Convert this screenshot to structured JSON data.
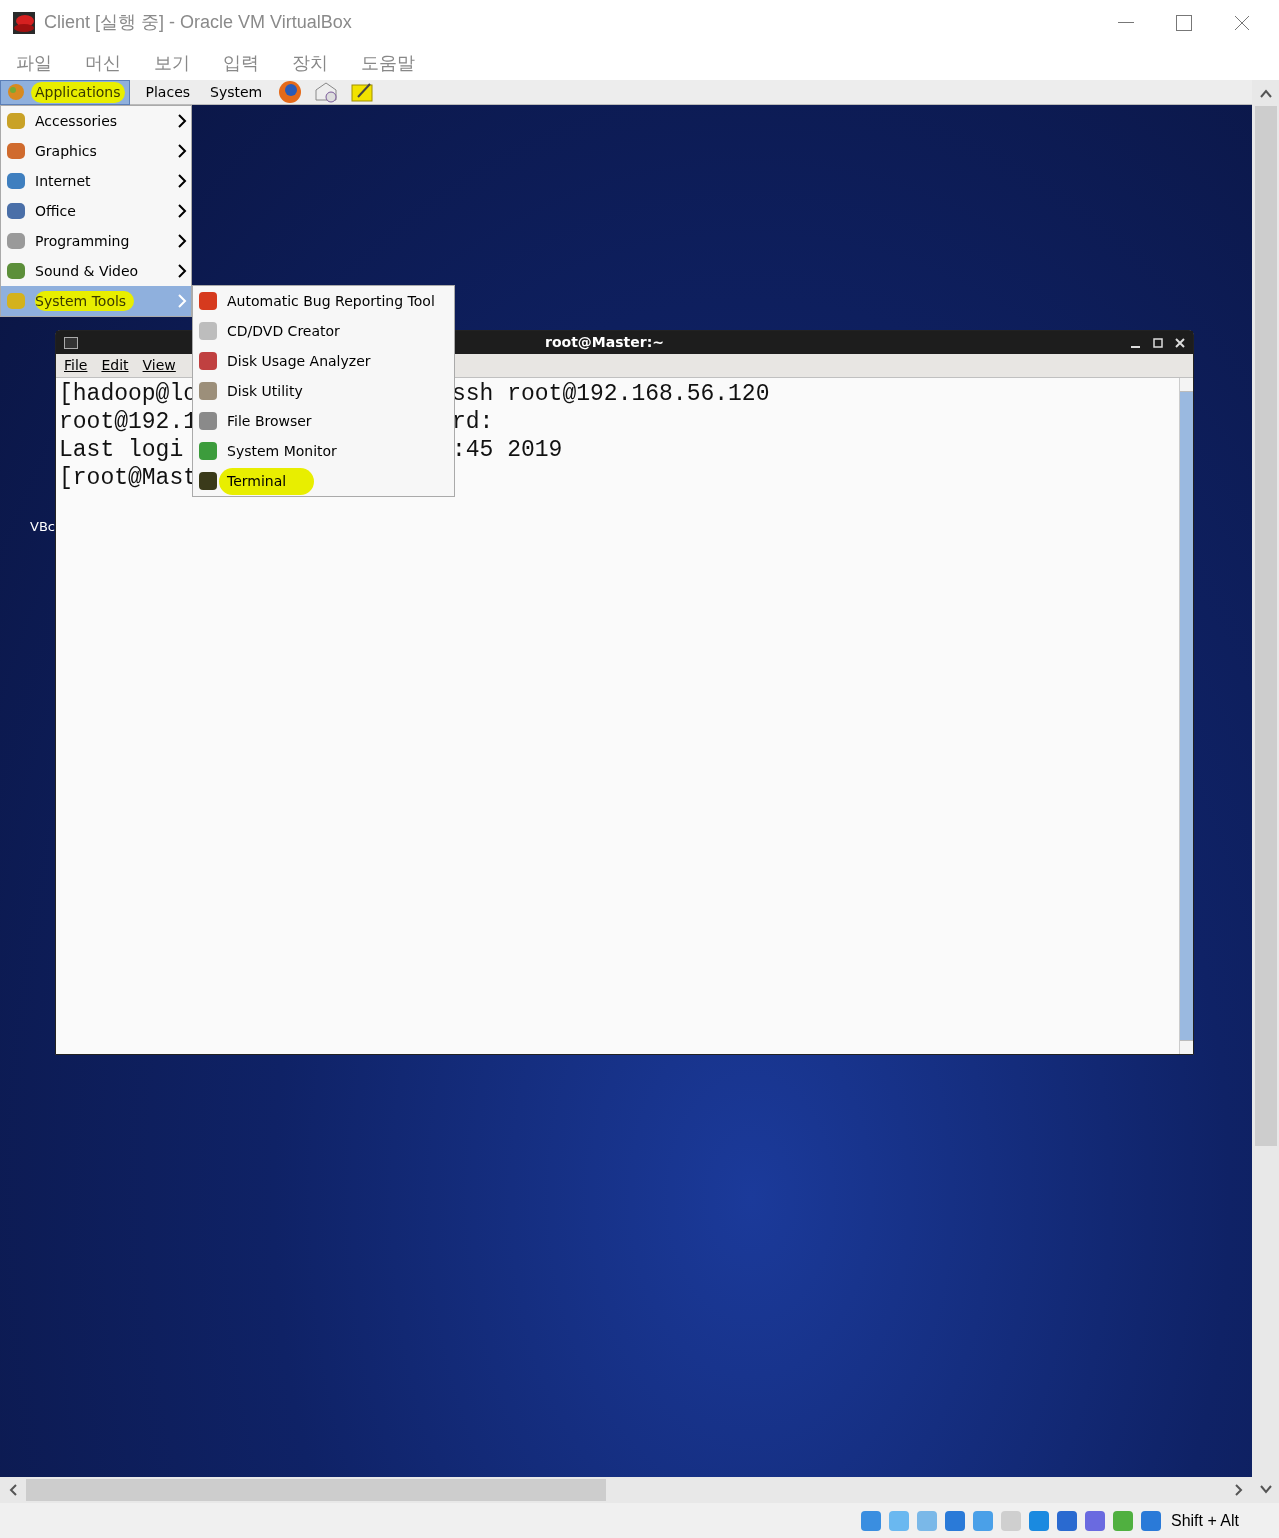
{
  "window": {
    "title": "Client [실행 중] - Oracle VM VirtualBox"
  },
  "menu_bar": [
    "파일",
    "머신",
    "보기",
    "입력",
    "장치",
    "도움말"
  ],
  "panel": {
    "items": [
      {
        "label": "Applications",
        "selected": true,
        "marked": true
      },
      {
        "label": "Places",
        "selected": false,
        "marked": false
      },
      {
        "label": "System",
        "selected": false,
        "marked": false
      }
    ]
  },
  "applications_menu": [
    {
      "label": "Accessories",
      "selected": false,
      "marked": false
    },
    {
      "label": "Graphics",
      "selected": false,
      "marked": false
    },
    {
      "label": "Internet",
      "selected": false,
      "marked": false
    },
    {
      "label": "Office",
      "selected": false,
      "marked": false
    },
    {
      "label": "Programming",
      "selected": false,
      "marked": false
    },
    {
      "label": "Sound & Video",
      "selected": false,
      "marked": false
    },
    {
      "label": "System Tools",
      "selected": true,
      "marked": true
    }
  ],
  "system_tools_menu": [
    {
      "label": "Automatic Bug Reporting Tool",
      "marked": false
    },
    {
      "label": "CD/DVD Creator",
      "marked": false
    },
    {
      "label": "Disk Usage Analyzer",
      "marked": false
    },
    {
      "label": "Disk Utility",
      "marked": false
    },
    {
      "label": "File Browser",
      "marked": false
    },
    {
      "label": "System Monitor",
      "marked": false
    },
    {
      "label": "Terminal",
      "marked": true
    }
  ],
  "desktop_icon_label": "VBc",
  "terminal": {
    "title": "root@Master:~",
    "menu": [
      "File",
      "Edit",
      "View"
    ],
    "lines": [
      {
        "left": "[hadoop@lo",
        "right": "ssh root@192.168.56.120"
      },
      {
        "left": "root@192.1",
        "right": "rd:"
      },
      {
        "left": "Last logi",
        "right": ":45 2019"
      },
      {
        "left": "[root@Mast"
      }
    ]
  },
  "status_bar": {
    "host_key": "Shift + Alt"
  }
}
